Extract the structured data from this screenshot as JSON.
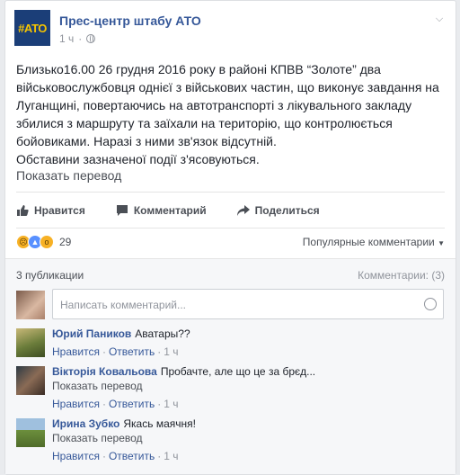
{
  "post": {
    "page_name": "Прес-центр штабу АТО",
    "avatar_text": "#АТО",
    "time": "1 ч",
    "text_lines": [
      "Близько16.00 26 грудня 2016 року в районі КПВВ “Золоте” два",
      "військовослужбовця однієї з військових частин, що виконує завдання на",
      "Луганщині, повертаючись на автотранспорті з лікувального закладу",
      "збилися з маршруту та заїхали на територію, що контролюється",
      "бойовиками. Наразі з ними зв'язок відсутній.",
      "Обставини зазначеної події з'ясовуються."
    ],
    "translate_label": "Показать перевод"
  },
  "actions": {
    "like": "Нравится",
    "comment": "Комментарий",
    "share": "Поделиться"
  },
  "reactions": {
    "count": "29",
    "sort_label": "Популярные комментарии"
  },
  "summary": {
    "publications": "3 публикации",
    "comments_count": "Комментарии: (3)"
  },
  "composer": {
    "placeholder": "Написать комментарий..."
  },
  "comments": [
    {
      "author": "Юрий Паников",
      "text": "Аватары??",
      "translate": "",
      "like": "Нравится",
      "reply": "Ответить",
      "time": "1 ч"
    },
    {
      "author": "Вікторія Ковальова",
      "text": "Пробачте, але що це за брєд...",
      "translate": "Показать перевод",
      "like": "Нравится",
      "reply": "Ответить",
      "time": "1 ч"
    },
    {
      "author": "Ирина Зубко",
      "text": "Якась маячня!",
      "translate": "Показать перевод",
      "like": "Нравится",
      "reply": "Ответить",
      "time": "1 ч"
    }
  ],
  "colors": {
    "link": "#365899",
    "muted": "#90949c",
    "background": "#e9ebee"
  }
}
